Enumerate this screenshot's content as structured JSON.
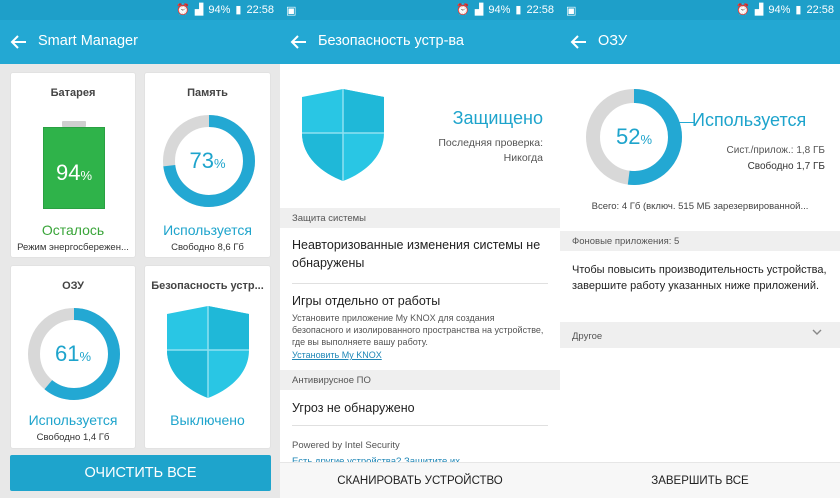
{
  "status": {
    "battery": "94%",
    "time": "22:58"
  },
  "colors": {
    "accent": "#23a8d3",
    "green": "#2fb34a",
    "ring_track": "#d8d8d8"
  },
  "screen1": {
    "title": "Smart Manager",
    "battery": {
      "title": "Батарея",
      "percent": "94",
      "percent_unit": "%",
      "status": "Осталось",
      "sub": "Режим энергосбережен..."
    },
    "memory": {
      "title": "Память",
      "percent": "73",
      "percent_unit": "%",
      "status": "Используется",
      "sub": "Свободно 8,6 Гб",
      "fraction": 0.73
    },
    "ram": {
      "title": "ОЗУ",
      "percent": "61",
      "percent_unit": "%",
      "status": "Используется",
      "sub": "Свободно 1,4 Гб",
      "fraction": 0.61
    },
    "security": {
      "title": "Безопасность устр...",
      "status": "Выключено",
      "icon": "shield-icon"
    },
    "clean_button": "ОЧИСТИТЬ ВСЕ"
  },
  "screen2": {
    "title": "Безопасность устр-ва",
    "status": "Защищено",
    "last_check_label": "Последняя проверка:",
    "last_check_value": "Никогда",
    "section_system": "Защита системы",
    "row_unauth": "Неавторизованные изменения системы не обнаружены",
    "row_knox_title": "Игры отдельно от работы",
    "row_knox_desc": "Установите приложение My KNOX для создания безопасного и изолированного пространства на устройстве, где вы выполняете вашу работу.",
    "row_knox_link": "Установить My KNOX",
    "section_antivirus": "Антивирусное ПО",
    "row_threats": "Угроз не обнаружено",
    "powered": "Powered by Intel Security",
    "powered_link": "Есть другие устройства? Защитите их",
    "scan_button": "СКАНИРОВАТЬ УСТРОЙСТВО"
  },
  "screen3": {
    "title": "ОЗУ",
    "percent": "52",
    "percent_unit": "%",
    "fraction": 0.52,
    "status": "Используется",
    "sys_apps": "Сист./прилож.: 1,8 ГБ",
    "free": "Свободно 1,7 ГБ",
    "total": "Всего: 4 Гб (включ. 515 МБ зарезервированной...",
    "section_bg": "Фоновые приложения: 5",
    "desc": "Чтобы повысить производительность устройства, завершите работу указанных ниже приложений.",
    "section_other": "Другое",
    "finish_button": "ЗАВЕРШИТЬ ВСЕ"
  }
}
